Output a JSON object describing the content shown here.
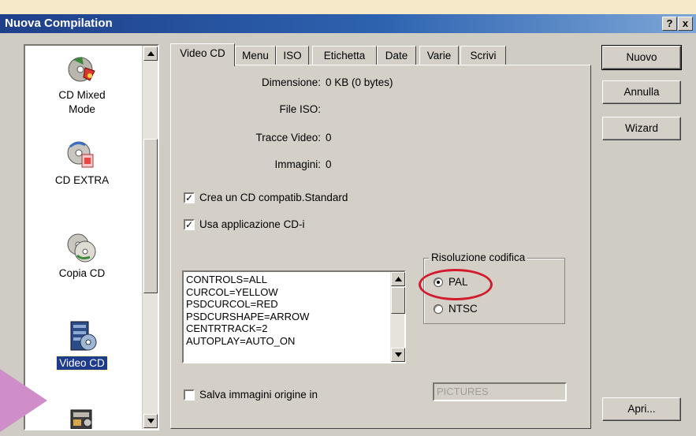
{
  "window": {
    "title": "Nuova Compilation",
    "help_label": "?",
    "close_label": "x"
  },
  "icon_list": {
    "items": [
      {
        "label_line1": "CD Mixed",
        "label_line2": "Mode"
      },
      {
        "label_line1": "CD EXTRA",
        "label_line2": ""
      },
      {
        "label_line1": "Copia CD",
        "label_line2": ""
      },
      {
        "label_line1": "Video CD",
        "label_line2": "",
        "selected": true
      },
      {
        "label_line1": "",
        "label_line2": ""
      }
    ]
  },
  "tabs": [
    "Video CD",
    "Menu",
    "ISO",
    "Etichetta",
    "Date",
    "Varie",
    "Scrivi"
  ],
  "active_tab": "Video CD",
  "info": {
    "dimensione_label": "Dimensione:",
    "dimensione_value": "0 KB (0 bytes)",
    "file_iso_label": "File ISO:",
    "file_iso_value": "",
    "tracce_label": "Tracce Video:",
    "tracce_value": "0",
    "immagini_label": "Immagini:",
    "immagini_value": "0"
  },
  "checkboxes": {
    "crea_label": "Crea un CD compatib.Standard",
    "crea_checked": true,
    "usa_label": "Usa applicazione CD-i",
    "usa_checked": true,
    "salva_label": "Salva immagini origine in",
    "salva_checked": false
  },
  "cdi_settings": [
    "CONTROLS=ALL",
    "CURCOL=YELLOW",
    "PSDCURCOL=RED",
    "PSDCURSHAPE=ARROW",
    "CENTRTRACK=2",
    "AUTOPLAY=AUTO_ON"
  ],
  "risoluzione": {
    "legend": "Risoluzione codifica",
    "pal_label": "PAL",
    "ntsc_label": "NTSC",
    "selected": "PAL"
  },
  "pictures_field_value": "PICTURES",
  "buttons": {
    "nuovo": "Nuovo",
    "annulla": "Annulla",
    "wizard": "Wizard",
    "apri": "Apri..."
  },
  "colors": {
    "title_bar": "#1f3f8a",
    "selection": "#1f3b8c",
    "highlight_ellipse": "#d21b2d",
    "pointer_arrow": "#cf8ec9"
  }
}
